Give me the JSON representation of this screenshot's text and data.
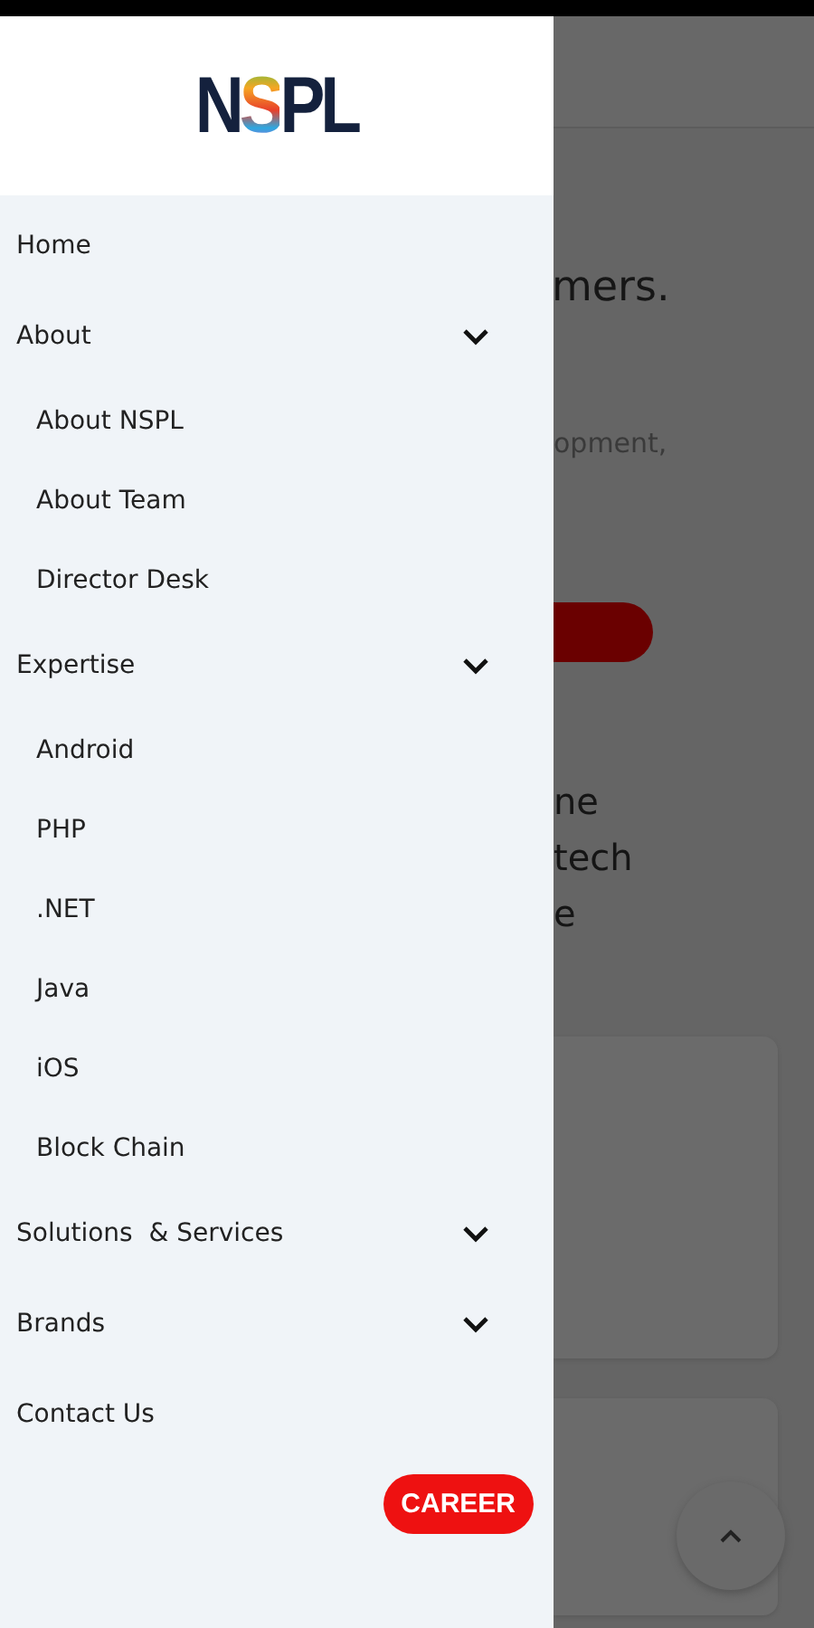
{
  "drawer": {
    "logo": "NSPL",
    "menu": [
      {
        "label": "Home",
        "kind": "link"
      },
      {
        "label": "About",
        "kind": "dropdown",
        "children": [
          "About NSPL",
          "About Team",
          "Director Desk"
        ]
      },
      {
        "label": "Expertise",
        "kind": "dropdown",
        "children": [
          "Android",
          "PHP",
          ".NET",
          "Java",
          "iOS",
          "Block Chain"
        ]
      },
      {
        "label": "Solutions  & Services",
        "kind": "dropdown"
      },
      {
        "label": "Brands",
        "kind": "dropdown"
      },
      {
        "label": "Contact Us",
        "kind": "link"
      }
    ],
    "career_button": "CAREER"
  },
  "page_behind": {
    "heading": "mers.",
    "subtitle": "opment,",
    "text_lines": [
      "ne",
      "tech",
      "e"
    ]
  }
}
